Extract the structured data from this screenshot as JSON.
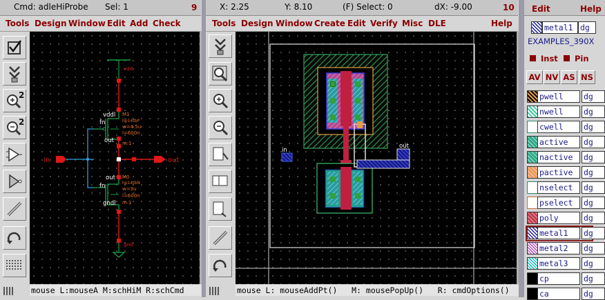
{
  "schematic": {
    "title": {
      "cmd": "Cmd: adleHiProbe",
      "sel": "Sel: 1",
      "num": "9"
    },
    "menus": [
      "Tools",
      "Design",
      "Window",
      "Edit",
      "Add",
      "Check"
    ],
    "status": "mouse L:mouseA M:schHiM R:schCmd",
    "labels": {
      "vdd": "vdd",
      "gnd": "gnd",
      "in": "in",
      "out": "out",
      "vddl": "vddl",
      "gndl": "gndl",
      "fn_p": "fn",
      "fn_n": "fn",
      "outl_p": "out",
      "outl_n": "out",
      "m1": [
        "M1",
        "hp14tbP",
        "w=4.5u",
        "l=600n",
        "m:1"
      ],
      "m0": [
        "M0",
        "hp14tbN",
        "w=3u",
        "l=600n",
        "m:1"
      ]
    },
    "tools": [
      "check-icon",
      "probe-icon",
      "zoom-in-icon",
      "zoom-out-icon",
      "place-instance-icon",
      "place-gate-icon",
      "wire-icon",
      "undo-icon",
      "pins-icon"
    ],
    "zoom_sup": "2"
  },
  "layout": {
    "title": {
      "x": "X: 2.25",
      "y": "Y: 8.10",
      "select": "(F) Select: 0",
      "dx": "dX: -9.00",
      "num": "10"
    },
    "menus": [
      "Tools",
      "Design",
      "Window",
      "Create",
      "Edit",
      "Verify",
      "Misc",
      "DLE",
      "Help"
    ],
    "status": "mouse L: mouseAddPt()   M: mousePopUp()   R: cmdOptions()",
    "labels": {
      "in": "in",
      "out": "out"
    }
  },
  "palette": {
    "menus": [
      "Edit",
      "Help"
    ],
    "current": {
      "layer": "metal1",
      "purpose": "dg"
    },
    "library": "EXAMPLES_390X",
    "options": [
      "Inst",
      "Pin"
    ],
    "buttons": [
      "AV",
      "NV",
      "AS",
      "NS"
    ],
    "layers": [
      {
        "name": "pwell",
        "purpose": "dg",
        "color": "#e8a050"
      },
      {
        "name": "nwell",
        "purpose": "dg",
        "color": "#3cc8a0"
      },
      {
        "name": "cwell",
        "purpose": "dg",
        "color": "#ffffff"
      },
      {
        "name": "active",
        "purpose": "dg",
        "color": "#2eaa80"
      },
      {
        "name": "nactive",
        "purpose": "dg",
        "color": "#2eaa80"
      },
      {
        "name": "pactive",
        "purpose": "dg",
        "color": "#e8a050"
      },
      {
        "name": "nselect",
        "purpose": "dg",
        "color": "#ffffff"
      },
      {
        "name": "pselect",
        "purpose": "dg",
        "color": "#ffffff"
      },
      {
        "name": "poly",
        "purpose": "dg",
        "color": "#c04050"
      },
      {
        "name": "metal1",
        "purpose": "dg",
        "color": "#6a6ad0"
      },
      {
        "name": "metal2",
        "purpose": "dg",
        "color": "#c060c0"
      },
      {
        "name": "metal3",
        "purpose": "dg",
        "color": "#30c0c0"
      },
      {
        "name": "cp",
        "purpose": "dg",
        "color": "#000000"
      },
      {
        "name": "ca",
        "purpose": "dg",
        "color": "#000000"
      }
    ]
  }
}
